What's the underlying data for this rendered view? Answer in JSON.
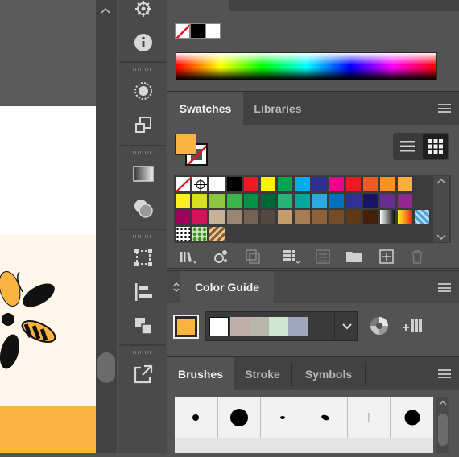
{
  "swatches_panel": {
    "tabs": [
      {
        "label": "Swatches",
        "active": true
      },
      {
        "label": "Libraries",
        "active": false
      }
    ],
    "fill_color": "#fbb440",
    "stroke": "none",
    "view_buttons": [
      "list-view-icon",
      "thumbnail-view-icon"
    ],
    "swatch_rows": [
      [
        "none",
        "registration",
        "#ffffff",
        "#000000",
        "#ed1c24",
        "#fff200",
        "#00a651",
        "#00aeef",
        "#2e3192",
        "#ec008c",
        "#ed1c24",
        "#f15a24",
        "#f7931e",
        "#fbb03b"
      ],
      [
        "#fcee21",
        "#d9e021",
        "#8cc63f",
        "#39b54a",
        "#009245",
        "#006837",
        "#22b573",
        "#00a99d",
        "#29abe2",
        "#0071bc",
        "#2e3192",
        "#1b1464",
        "#662d91",
        "#93278f"
      ],
      [
        "#9e005d",
        "#d4145a",
        "#c7b299",
        "#998675",
        "#736357",
        "#534741",
        "#c69c6d",
        "#a67c52",
        "#8c6239",
        "#754c24",
        "#603813",
        "#42210b",
        "gradient-bw",
        "gradient-orange",
        "pattern-blue"
      ],
      [
        "pattern-dots",
        "pattern-leaves",
        "pattern-brown"
      ]
    ],
    "bottom_icons": [
      "swatch-libraries-icon",
      "place-swatch-icon",
      "show-kinds-icon",
      "group-icon",
      "swatch-options-icon",
      "new-group-folder-icon",
      "new-swatch-icon",
      "delete-swatch-icon"
    ]
  },
  "color_guide_panel": {
    "title": "Color Guide",
    "base_color": "#fbb440",
    "harmony_colors": [
      "#ffffff",
      "#c0aea8",
      "#b8b8aa",
      "#cfe6cf",
      "#a0a6be"
    ]
  },
  "brushes_panel": {
    "tabs": [
      {
        "label": "Brushes",
        "active": true
      },
      {
        "label": "Stroke",
        "active": false
      },
      {
        "label": "Symbols",
        "active": false
      }
    ]
  },
  "top_gradient_panel": {
    "swatches": [
      "none",
      "#000000",
      "#ffffff"
    ]
  }
}
